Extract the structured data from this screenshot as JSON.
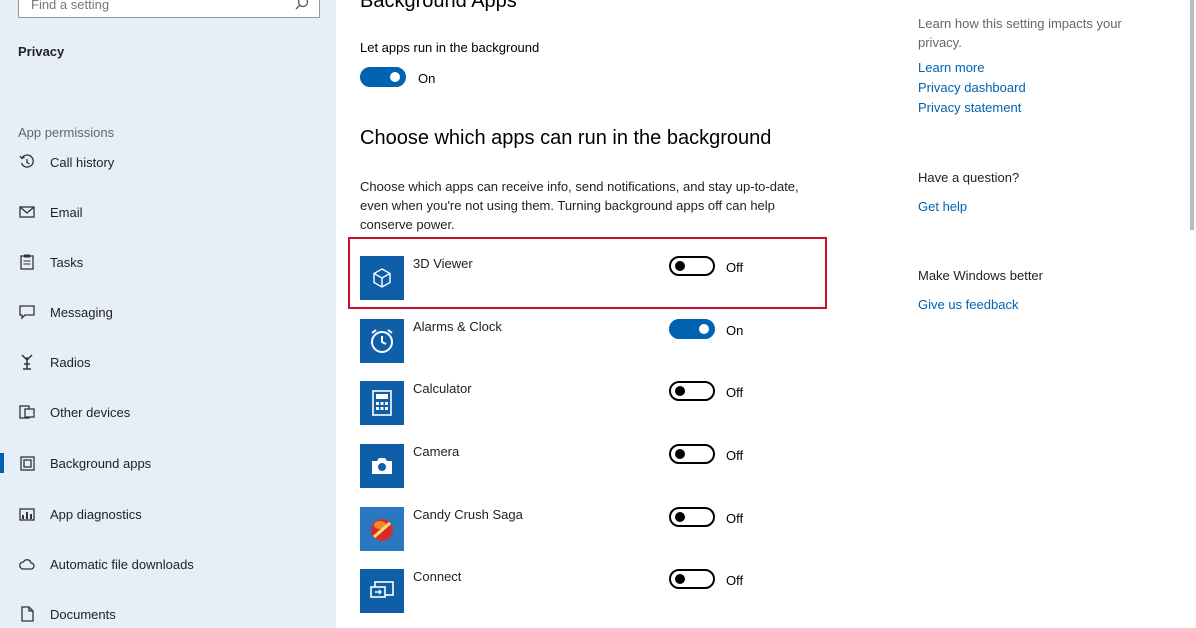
{
  "search": {
    "placeholder": "Find a setting"
  },
  "sidebar": {
    "title": "Privacy",
    "permissions_label": "App permissions",
    "items": [
      {
        "label": "Call history",
        "icon": "history-icon"
      },
      {
        "label": "Email",
        "icon": "email-icon"
      },
      {
        "label": "Tasks",
        "icon": "tasks-icon"
      },
      {
        "label": "Messaging",
        "icon": "messaging-icon"
      },
      {
        "label": "Radios",
        "icon": "radios-icon"
      },
      {
        "label": "Other devices",
        "icon": "devices-icon"
      },
      {
        "label": "Background apps",
        "icon": "background-apps-icon",
        "selected": true
      },
      {
        "label": "App diagnostics",
        "icon": "diagnostics-icon"
      },
      {
        "label": "Automatic file downloads",
        "icon": "cloud-icon"
      },
      {
        "label": "Documents",
        "icon": "document-icon"
      }
    ]
  },
  "main": {
    "heading": "Background Apps",
    "let_apps_label": "Let apps run in the background",
    "master_state": "On",
    "subheading": "Choose which apps can run in the background",
    "description": "Choose which apps can receive info, send notifications, and stay up-to-date, even when you're not using them. Turning background apps off can help conserve power.",
    "apps": [
      {
        "name": "3D Viewer",
        "state": "Off",
        "icon": "cube-icon"
      },
      {
        "name": "Alarms & Clock",
        "state": "On",
        "icon": "clock-icon"
      },
      {
        "name": "Calculator",
        "state": "Off",
        "icon": "calculator-icon"
      },
      {
        "name": "Camera",
        "state": "Off",
        "icon": "camera-icon"
      },
      {
        "name": "Candy Crush Saga",
        "state": "Off",
        "icon": "candy-icon"
      },
      {
        "name": "Connect",
        "state": "Off",
        "icon": "connect-icon"
      }
    ]
  },
  "right": {
    "impact_text": "Learn how this setting impacts your privacy.",
    "learn_more": "Learn more",
    "privacy_dashboard": "Privacy dashboard",
    "privacy_statement": "Privacy statement",
    "question_heading": "Have a question?",
    "get_help": "Get help",
    "better_heading": "Make Windows better",
    "feedback": "Give us feedback"
  },
  "colors": {
    "accent": "#0063b1",
    "highlight": "#c8102e",
    "sidebar_bg": "#e6eef8"
  }
}
